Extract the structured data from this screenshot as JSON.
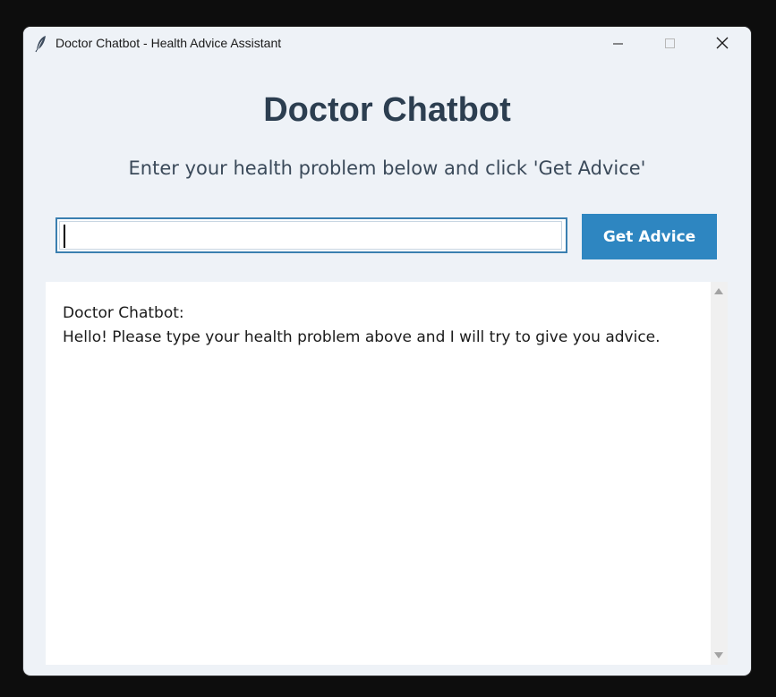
{
  "window": {
    "title": "Doctor Chatbot - Health Advice Assistant",
    "icon": "feather-icon",
    "controls": {
      "minimize_icon": "minimize-icon",
      "maximize_icon": "maximize-icon",
      "close_icon": "close-icon"
    }
  },
  "main": {
    "heading": "Doctor Chatbot",
    "instructions": "Enter your health problem below and click 'Get Advice'",
    "input": {
      "value": "",
      "placeholder": ""
    },
    "button_label": "Get Advice"
  },
  "chat": {
    "messages": [
      {
        "sender": "Doctor Chatbot:",
        "text": "Hello! Please type your health problem above and I will try to give you advice."
      }
    ]
  },
  "colors": {
    "window_bg": "#eef2f7",
    "heading": "#2c3e50",
    "button_bg": "#2e86c1",
    "input_border": "#3a7fb0"
  }
}
